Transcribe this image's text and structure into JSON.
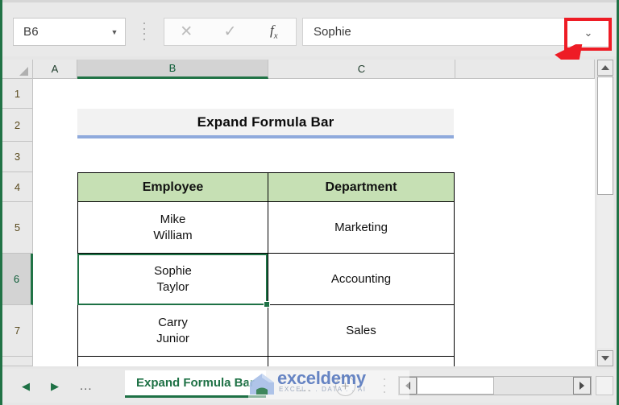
{
  "formula_bar": {
    "name_box_value": "B6",
    "name_box_caret_icon": "chevron-down-icon",
    "cancel_icon": "✕",
    "enter_icon": "✓",
    "insert_function_label": "fx",
    "formula_value": "Sophie",
    "expand_icon": "⌄",
    "callout_color": "#ee1c25"
  },
  "columns": [
    {
      "label": "A",
      "selected": false
    },
    {
      "label": "B",
      "selected": true
    },
    {
      "label": "C",
      "selected": false
    },
    {
      "label": "",
      "selected": false
    }
  ],
  "rows": [
    {
      "label": "1",
      "selected": false
    },
    {
      "label": "2",
      "selected": false
    },
    {
      "label": "3",
      "selected": false
    },
    {
      "label": "4",
      "selected": false
    },
    {
      "label": "5",
      "selected": false
    },
    {
      "label": "6",
      "selected": true
    },
    {
      "label": "7",
      "selected": false
    },
    {
      "label": "",
      "selected": false
    }
  ],
  "sheet": {
    "title": "Expand Formula Bar",
    "title_fill": "#f2f2f2",
    "title_underline": "#8faadc",
    "header_fill": "#c6e0b4",
    "selection_color": "#217346",
    "table": {
      "headers": [
        "Employee",
        "Department"
      ],
      "rows": [
        {
          "employee_line1": "Mike",
          "employee_line2": "William",
          "department": "Marketing"
        },
        {
          "employee_line1": "Sophie",
          "employee_line2": "Taylor",
          "department": "Accounting"
        },
        {
          "employee_line1": "Carry",
          "employee_line2": "Junior",
          "department": "Sales"
        }
      ]
    }
  },
  "tab_bar": {
    "prev_icon": "◀",
    "next_icon": "▶",
    "overflow_left": "...",
    "active_sheet": "Expand Formula Bar",
    "overflow_right": "...",
    "add_sheet_icon": "+",
    "menu_icon": "vertical-dots"
  },
  "watermark": {
    "text": "exceldemy",
    "subtitle": "EXCEL . . DATA . . AI",
    "color": "#5b7cc0"
  }
}
